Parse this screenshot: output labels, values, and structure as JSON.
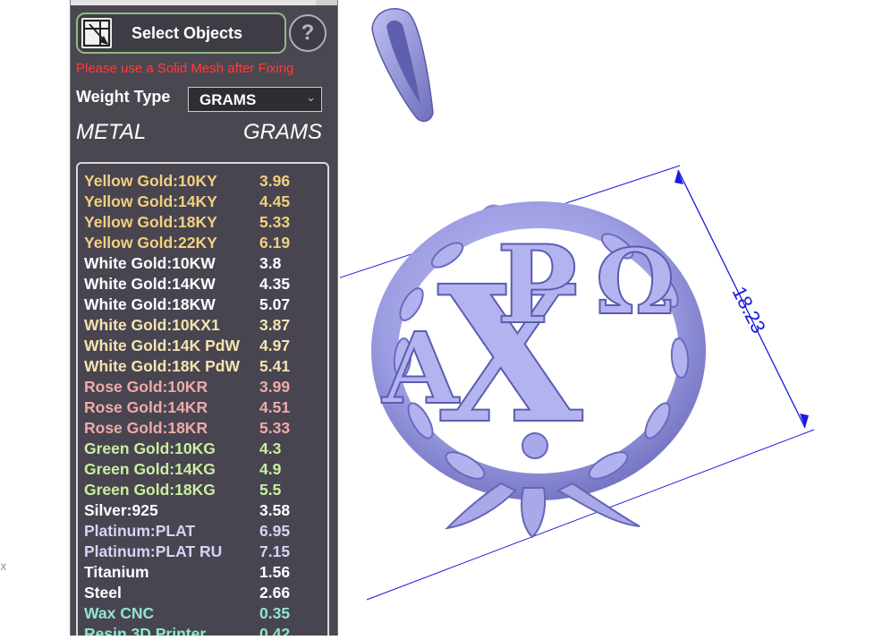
{
  "panel": {
    "select_button_label": "Select Objects",
    "help_label": "?",
    "warning": "Please use a Solid Mesh after Fixing",
    "weight_type_label": "Weight Type",
    "weight_type_value": "GRAMS",
    "metal_header": "METAL",
    "grams_header": "GRAMS",
    "rows": [
      {
        "name": "Yellow Gold:10KY",
        "value": "3.96",
        "color": "#f3d07e"
      },
      {
        "name": "Yellow Gold:14KY",
        "value": "4.45",
        "color": "#f3d07e"
      },
      {
        "name": "Yellow Gold:18KY",
        "value": "5.33",
        "color": "#f3d07e"
      },
      {
        "name": "Yellow Gold:22KY",
        "value": "6.19",
        "color": "#f3d07e"
      },
      {
        "name": "White Gold:10KW",
        "value": "3.8",
        "color": "#ffffff"
      },
      {
        "name": "White Gold:14KW",
        "value": "4.35",
        "color": "#ffffff"
      },
      {
        "name": "White Gold:18KW",
        "value": "5.07",
        "color": "#ffffff"
      },
      {
        "name": "White Gold:10KX1",
        "value": "3.87",
        "color": "#f6e4b0"
      },
      {
        "name": "White Gold:14K PdW",
        "value": "4.97",
        "color": "#f6e4b0"
      },
      {
        "name": "White Gold:18K PdW",
        "value": "5.41",
        "color": "#f6e4b0"
      },
      {
        "name": "Rose Gold:10KR",
        "value": "3.99",
        "color": "#f0aaa8"
      },
      {
        "name": "Rose Gold:14KR",
        "value": "4.51",
        "color": "#f0aaa8"
      },
      {
        "name": "Rose Gold:18KR",
        "value": "5.33",
        "color": "#f0aaa8"
      },
      {
        "name": "Green Gold:10KG",
        "value": "4.3",
        "color": "#c9efa0"
      },
      {
        "name": "Green Gold:14KG",
        "value": "4.9",
        "color": "#c9efa0"
      },
      {
        "name": "Green Gold:18KG",
        "value": "5.5",
        "color": "#c9efa0"
      },
      {
        "name": "Silver:925",
        "value": "3.58",
        "color": "#ffffff"
      },
      {
        "name": "Platinum:PLAT",
        "value": "6.95",
        "color": "#d7d2f6"
      },
      {
        "name": "Platinum:PLAT RU",
        "value": "7.15",
        "color": "#d7d2f6"
      },
      {
        "name": "Titanium",
        "value": "1.56",
        "color": "#ffffff"
      },
      {
        "name": "Steel",
        "value": "2.66",
        "color": "#ffffff"
      },
      {
        "name": "Wax  CNC",
        "value": "0.35",
        "color": "#8fe6cf"
      },
      {
        "name": "Resin 3D Printer",
        "value": "0.42",
        "color": "#8fe6cf"
      }
    ]
  },
  "viewport": {
    "dimension_label": "18.23",
    "letters": [
      "A",
      "P",
      "X",
      "Ω"
    ],
    "mesh_color": "#a9a9ea",
    "dimension_color": "#1a1ae0"
  },
  "margin_text": "x"
}
